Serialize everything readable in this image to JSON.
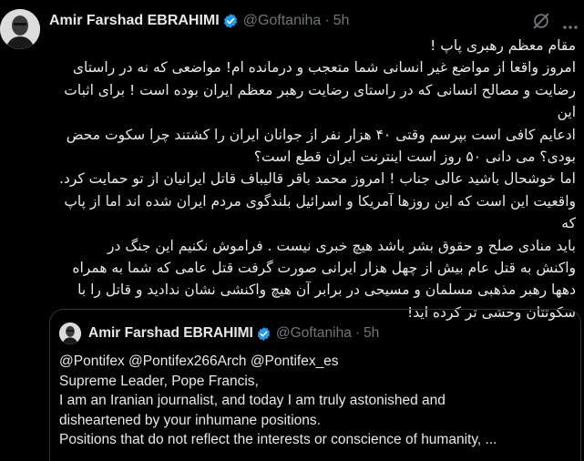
{
  "tweet": {
    "author_name": "Amir Farshad EBRAHIMI",
    "author_handle": "@Goftaniha",
    "separator": "·",
    "time": "5h",
    "icons": [
      "avatar",
      "verified-badge-icon",
      "grok-icon",
      "more-icon"
    ],
    "accent_color": "#1d9bf0",
    "body_lines": [
      "مقام معظم رهبری پاپ !",
      "امروز واقعا از مواضع غیر انسانی شما متعجب و درمانده ام! مواضعی که نه در راستای",
      "رضایت و مصالح انسانی که در راستای رضایت رهبر معظم ایران بوده است ! برای اثبات این",
      "ادعایم کافی است بپرسم وقتی ۴۰ هزار نفر از جوانان ایران را کشتند چرا سکوت محض",
      "بودی؟ می دانی ۵۰ روز است اینترنت ایران قطع است؟",
      "اما خوشحال باشید عالی جناب ! امروز محمد باقر قالیباف قاتل ایرانیان از تو حمایت کرد.",
      "واقعیت این است که این روزها آمریکا و اسرائیل بلندگوی مردم ایران شده اند اما از پاپ که",
      "باید منادی صلح و حقوق بشر باشد هیچ خبری نیست . فراموش نکنیم این جنگ در",
      "واکنش به قتل عام بیش از چهل هزار ایرانی صورت گرفت قتل عامی که شما به همراه",
      "دهها رهبر مذهبی مسلمان و مسیحی در برابر آن هیچ واکنشی نشان ندادید و قاتل را با",
      "سکوتتان وحشی تر کرده اید!"
    ]
  },
  "quoted_tweet": {
    "author_name": "Amir Farshad EBRAHIMI",
    "author_handle": "@Goftaniha",
    "separator": "·",
    "time": "5h",
    "body_lines": [
      "@Pontifex @Pontifex266Arch @Pontifex_es",
      "Supreme Leader, Pope Francis,",
      "I am an Iranian journalist, and today I am truly astonished and",
      "disheartened by your inhumane positions.",
      "Positions that do not reflect the interests or conscience of humanity, ..."
    ]
  }
}
